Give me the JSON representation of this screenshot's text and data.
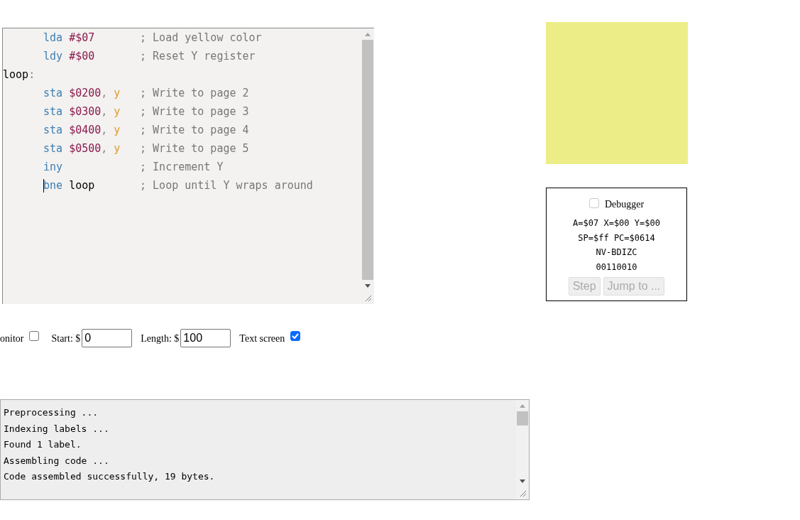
{
  "editor": {
    "lines": [
      {
        "tokens": [
          {
            "kind": "opcode",
            "text": "lda"
          },
          {
            "kind": "number",
            "text": "#$07"
          }
        ],
        "comment": "; Load yellow color",
        "cursor": false
      },
      {
        "tokens": [
          {
            "kind": "opcode",
            "text": "ldy"
          },
          {
            "kind": "number",
            "text": "#$00"
          }
        ],
        "comment": "; Reset Y register",
        "cursor": false
      },
      {
        "tokens": [
          {
            "kind": "label",
            "text": "loop"
          },
          {
            "kind": "punct",
            "text": ":"
          }
        ],
        "cursor": false
      },
      {
        "tokens": [
          {
            "kind": "opcode",
            "text": "sta"
          },
          {
            "kind": "number",
            "text": "$0200"
          },
          {
            "kind": "punct",
            "text": ","
          },
          {
            "kind": "register",
            "text": "y"
          }
        ],
        "comment": "; Write to page 2",
        "cursor": false
      },
      {
        "tokens": [
          {
            "kind": "opcode",
            "text": "sta"
          },
          {
            "kind": "number",
            "text": "$0300"
          },
          {
            "kind": "punct",
            "text": ","
          },
          {
            "kind": "register",
            "text": "y"
          }
        ],
        "comment": "; Write to page 3",
        "cursor": false
      },
      {
        "tokens": [
          {
            "kind": "opcode",
            "text": "sta"
          },
          {
            "kind": "number",
            "text": "$0400"
          },
          {
            "kind": "punct",
            "text": ","
          },
          {
            "kind": "register",
            "text": "y"
          }
        ],
        "comment": "; Write to page 4",
        "cursor": false
      },
      {
        "tokens": [
          {
            "kind": "opcode",
            "text": "sta"
          },
          {
            "kind": "number",
            "text": "$0500"
          },
          {
            "kind": "punct",
            "text": ","
          },
          {
            "kind": "register",
            "text": "y"
          }
        ],
        "comment": "; Write to page 5",
        "cursor": false
      },
      {
        "tokens": [
          {
            "kind": "opcode",
            "text": "iny"
          }
        ],
        "comment": "; Increment Y",
        "cursor": false
      },
      {
        "tokens": [
          {
            "kind": "opcode",
            "text": "bne"
          },
          {
            "kind": "labelref",
            "text": "loop"
          }
        ],
        "comment": "; Loop until Y wraps around",
        "cursor": true
      }
    ]
  },
  "controls": [
    {
      "kind": "checkbox",
      "label": "onitor",
      "checked": false
    },
    {
      "kind": "field",
      "label": "Start: $",
      "value": "0"
    },
    {
      "kind": "field",
      "label": "Length: $",
      "value": "100"
    },
    {
      "kind": "checkbox",
      "label": "Text screen",
      "checked": true
    }
  ],
  "display": {
    "color": "#eded87"
  },
  "debugger": {
    "label": "Debugger",
    "checked": false,
    "registers": [
      "A=$07 X=$00 Y=$00",
      "SP=$ff PC=$0614",
      "NV-BDIZC",
      "00110010"
    ],
    "buttons": [
      {
        "label": "Step",
        "disabled": true
      },
      {
        "label": "Jump to ...",
        "disabled": true
      }
    ]
  },
  "messages": [
    "Preprocessing ...",
    "Indexing labels ...",
    "Found 1 label.",
    "Assembling code ...",
    "Code assembled successfully, 19 bytes."
  ]
}
